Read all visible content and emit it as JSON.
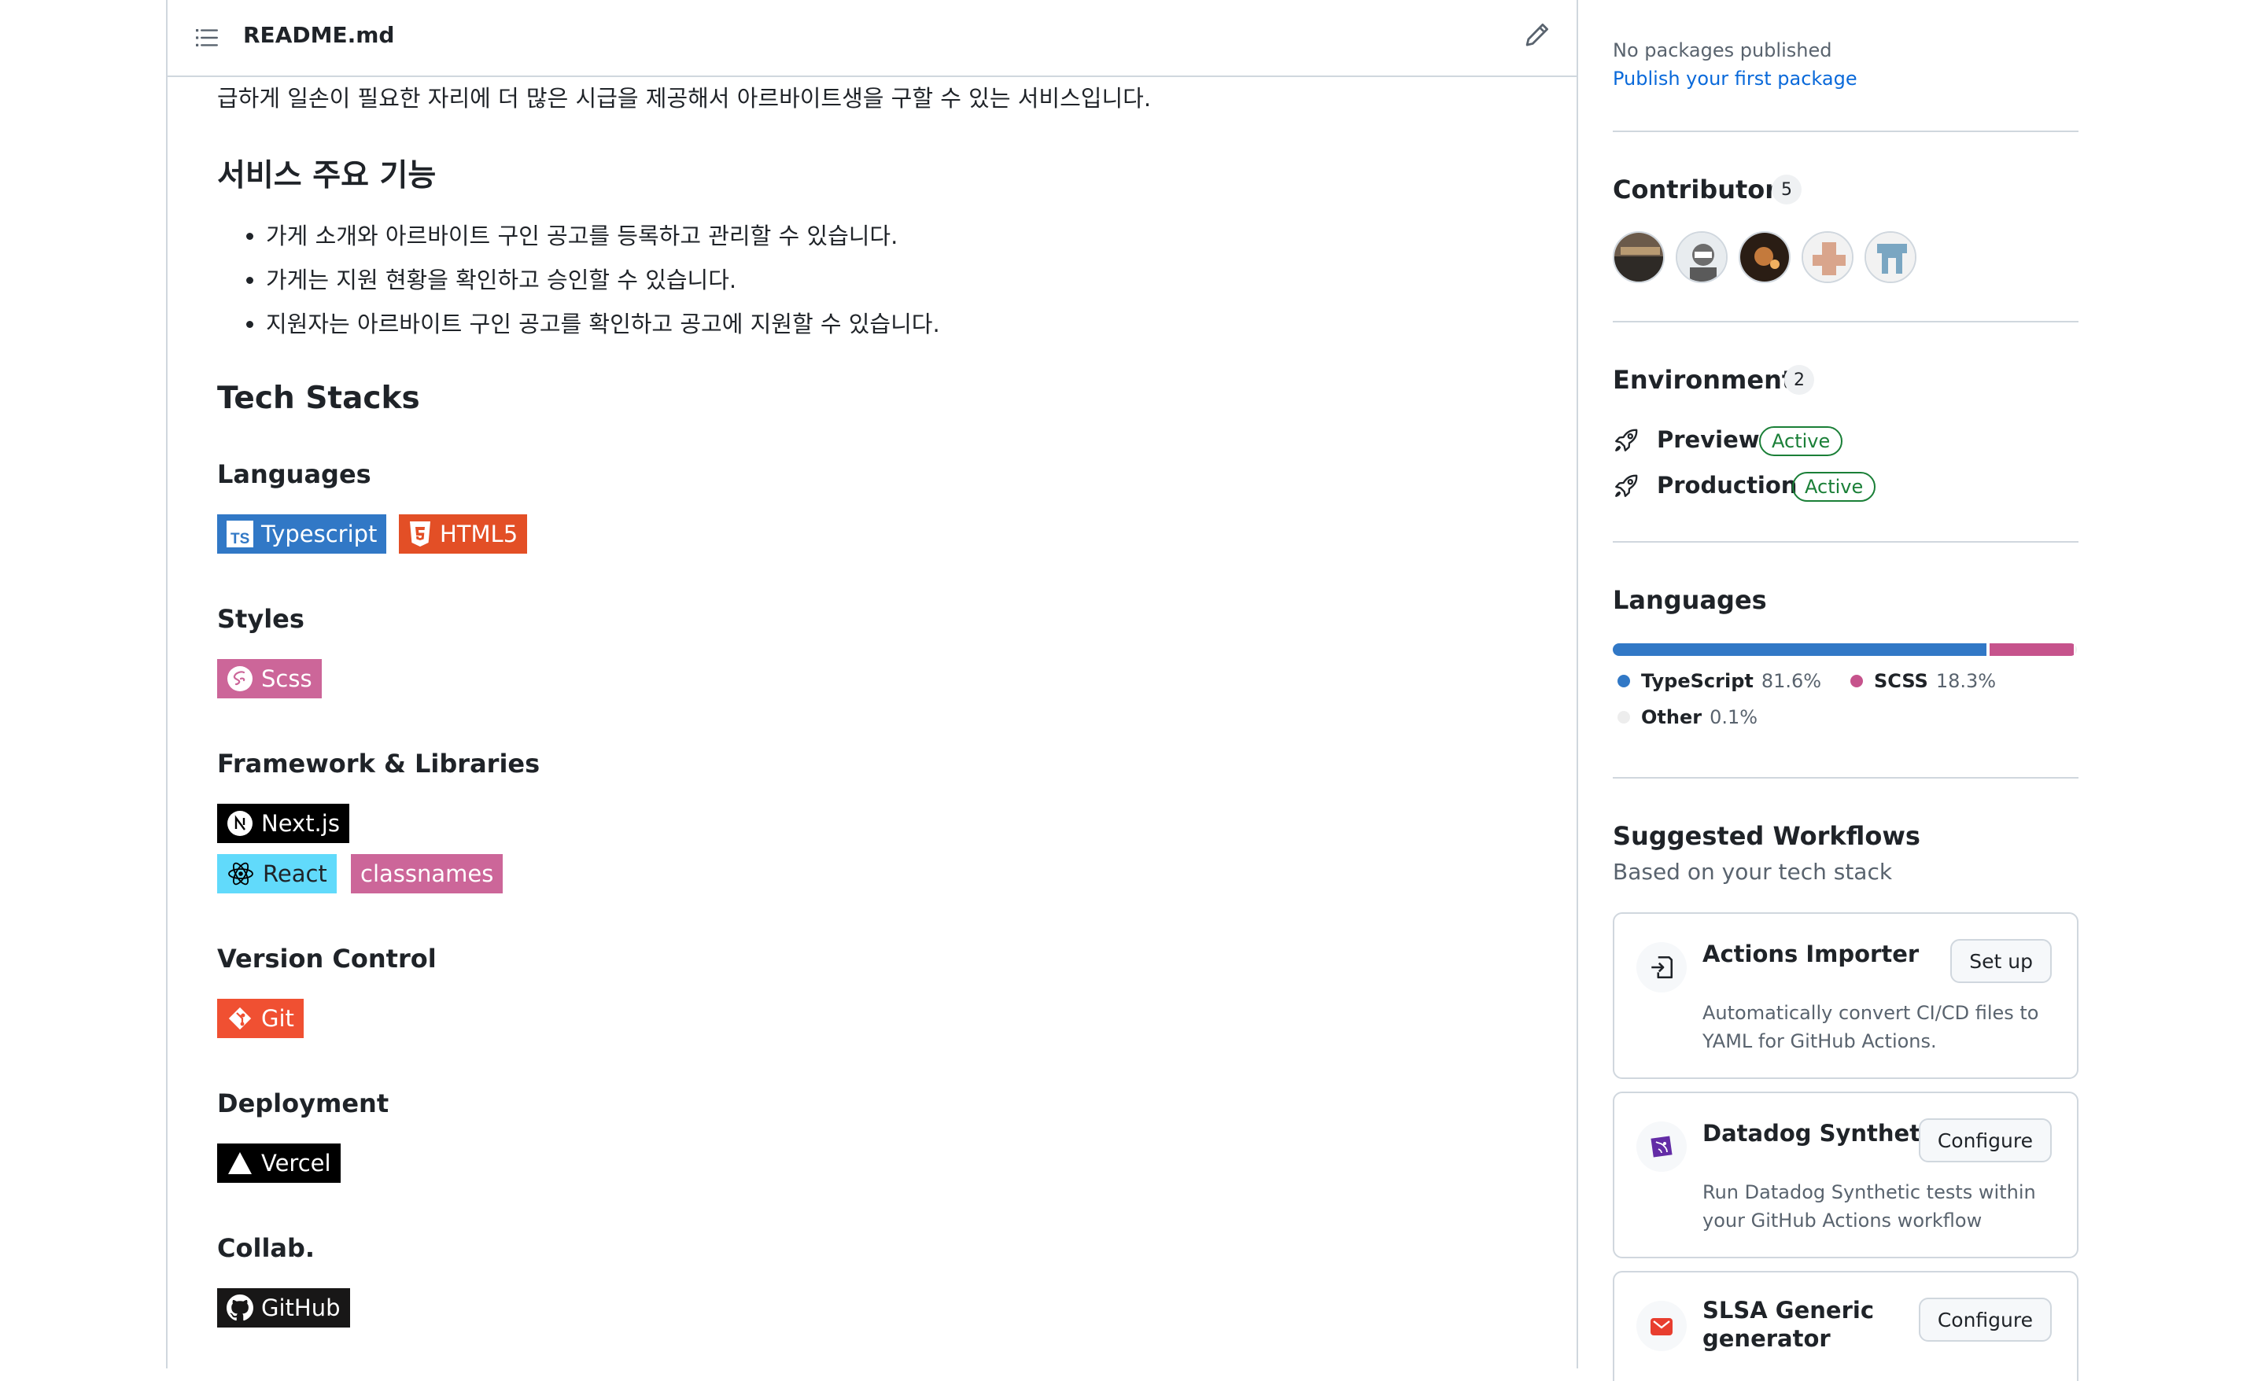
{
  "readme": {
    "file_name": "README.md",
    "intro": "급하게 일손이 필요한 자리에 더 많은 시급을 제공해서 아르바이트생을 구할 수 있는 서비스입니다.",
    "features_heading": "서비스 주요 기능",
    "features": [
      "가게 소개와 아르바이트 구인 공고를 등록하고 관리할 수 있습니다.",
      "가게는 지원 현황을 확인하고 승인할 수 있습니다.",
      "지원자는 아르바이트 구인 공고를 확인하고 공고에 지원할 수 있습니다."
    ],
    "tech_heading": "Tech Stacks",
    "sections": {
      "languages": "Languages",
      "styles": "Styles",
      "frameworks": "Framework & Libraries",
      "version_control": "Version Control",
      "deployment": "Deployment",
      "collab": "Collab."
    },
    "badges": {
      "typescript": {
        "label": "Typescript",
        "color": "#3178c6",
        "icon": "typescript-icon"
      },
      "html5": {
        "label": "HTML5",
        "color": "#e34f26",
        "icon": "html5-icon"
      },
      "scss": {
        "label": "Scss",
        "color": "#cc6699",
        "icon": "sass-icon"
      },
      "nextjs": {
        "label": "Next.js",
        "color": "#000000",
        "icon": "nextjs-icon"
      },
      "react": {
        "label": "React",
        "color": "#61dafb",
        "icon": "react-icon"
      },
      "classnames": {
        "label": "classnames",
        "color": "#cc6699"
      },
      "git": {
        "label": "Git",
        "color": "#f05032",
        "icon": "git-icon"
      },
      "vercel": {
        "label": "Vercel",
        "color": "#000000",
        "icon": "vercel-icon"
      },
      "github": {
        "label": "GitHub",
        "color": "#181717",
        "icon": "github-icon"
      }
    }
  },
  "sidebar": {
    "packages": {
      "empty_text": "No packages published",
      "link": "Publish your first package"
    },
    "contributors": {
      "title": "Contributors",
      "count": "5"
    },
    "environments": {
      "title": "Environments",
      "count": "2",
      "items": [
        {
          "name": "Preview",
          "status": "Active"
        },
        {
          "name": "Production",
          "status": "Active"
        }
      ]
    },
    "languages": {
      "title": "Languages",
      "items": [
        {
          "name": "TypeScript",
          "percent": "81.6%",
          "value": 81.6,
          "color": "#3178c6"
        },
        {
          "name": "SCSS",
          "percent": "18.3%",
          "value": 18.3,
          "color": "#c6538c"
        },
        {
          "name": "Other",
          "percent": "0.1%",
          "value": 0.1,
          "color": "#ededed"
        }
      ]
    },
    "workflows": {
      "title": "Suggested Workflows",
      "subtitle": "Based on your tech stack",
      "items": [
        {
          "title": "Actions Importer",
          "desc": "Automatically convert CI/CD files to YAML for GitHub Actions.",
          "button": "Set up",
          "icon": "import-icon"
        },
        {
          "title": "Datadog Synthetics",
          "desc": "Run Datadog Synthetic tests within your GitHub Actions workflow",
          "button": "Configure",
          "icon": "datadog-icon"
        },
        {
          "title": "SLSA Generic generator",
          "desc": "",
          "button": "Configure",
          "icon": "slsa-icon"
        }
      ]
    }
  }
}
